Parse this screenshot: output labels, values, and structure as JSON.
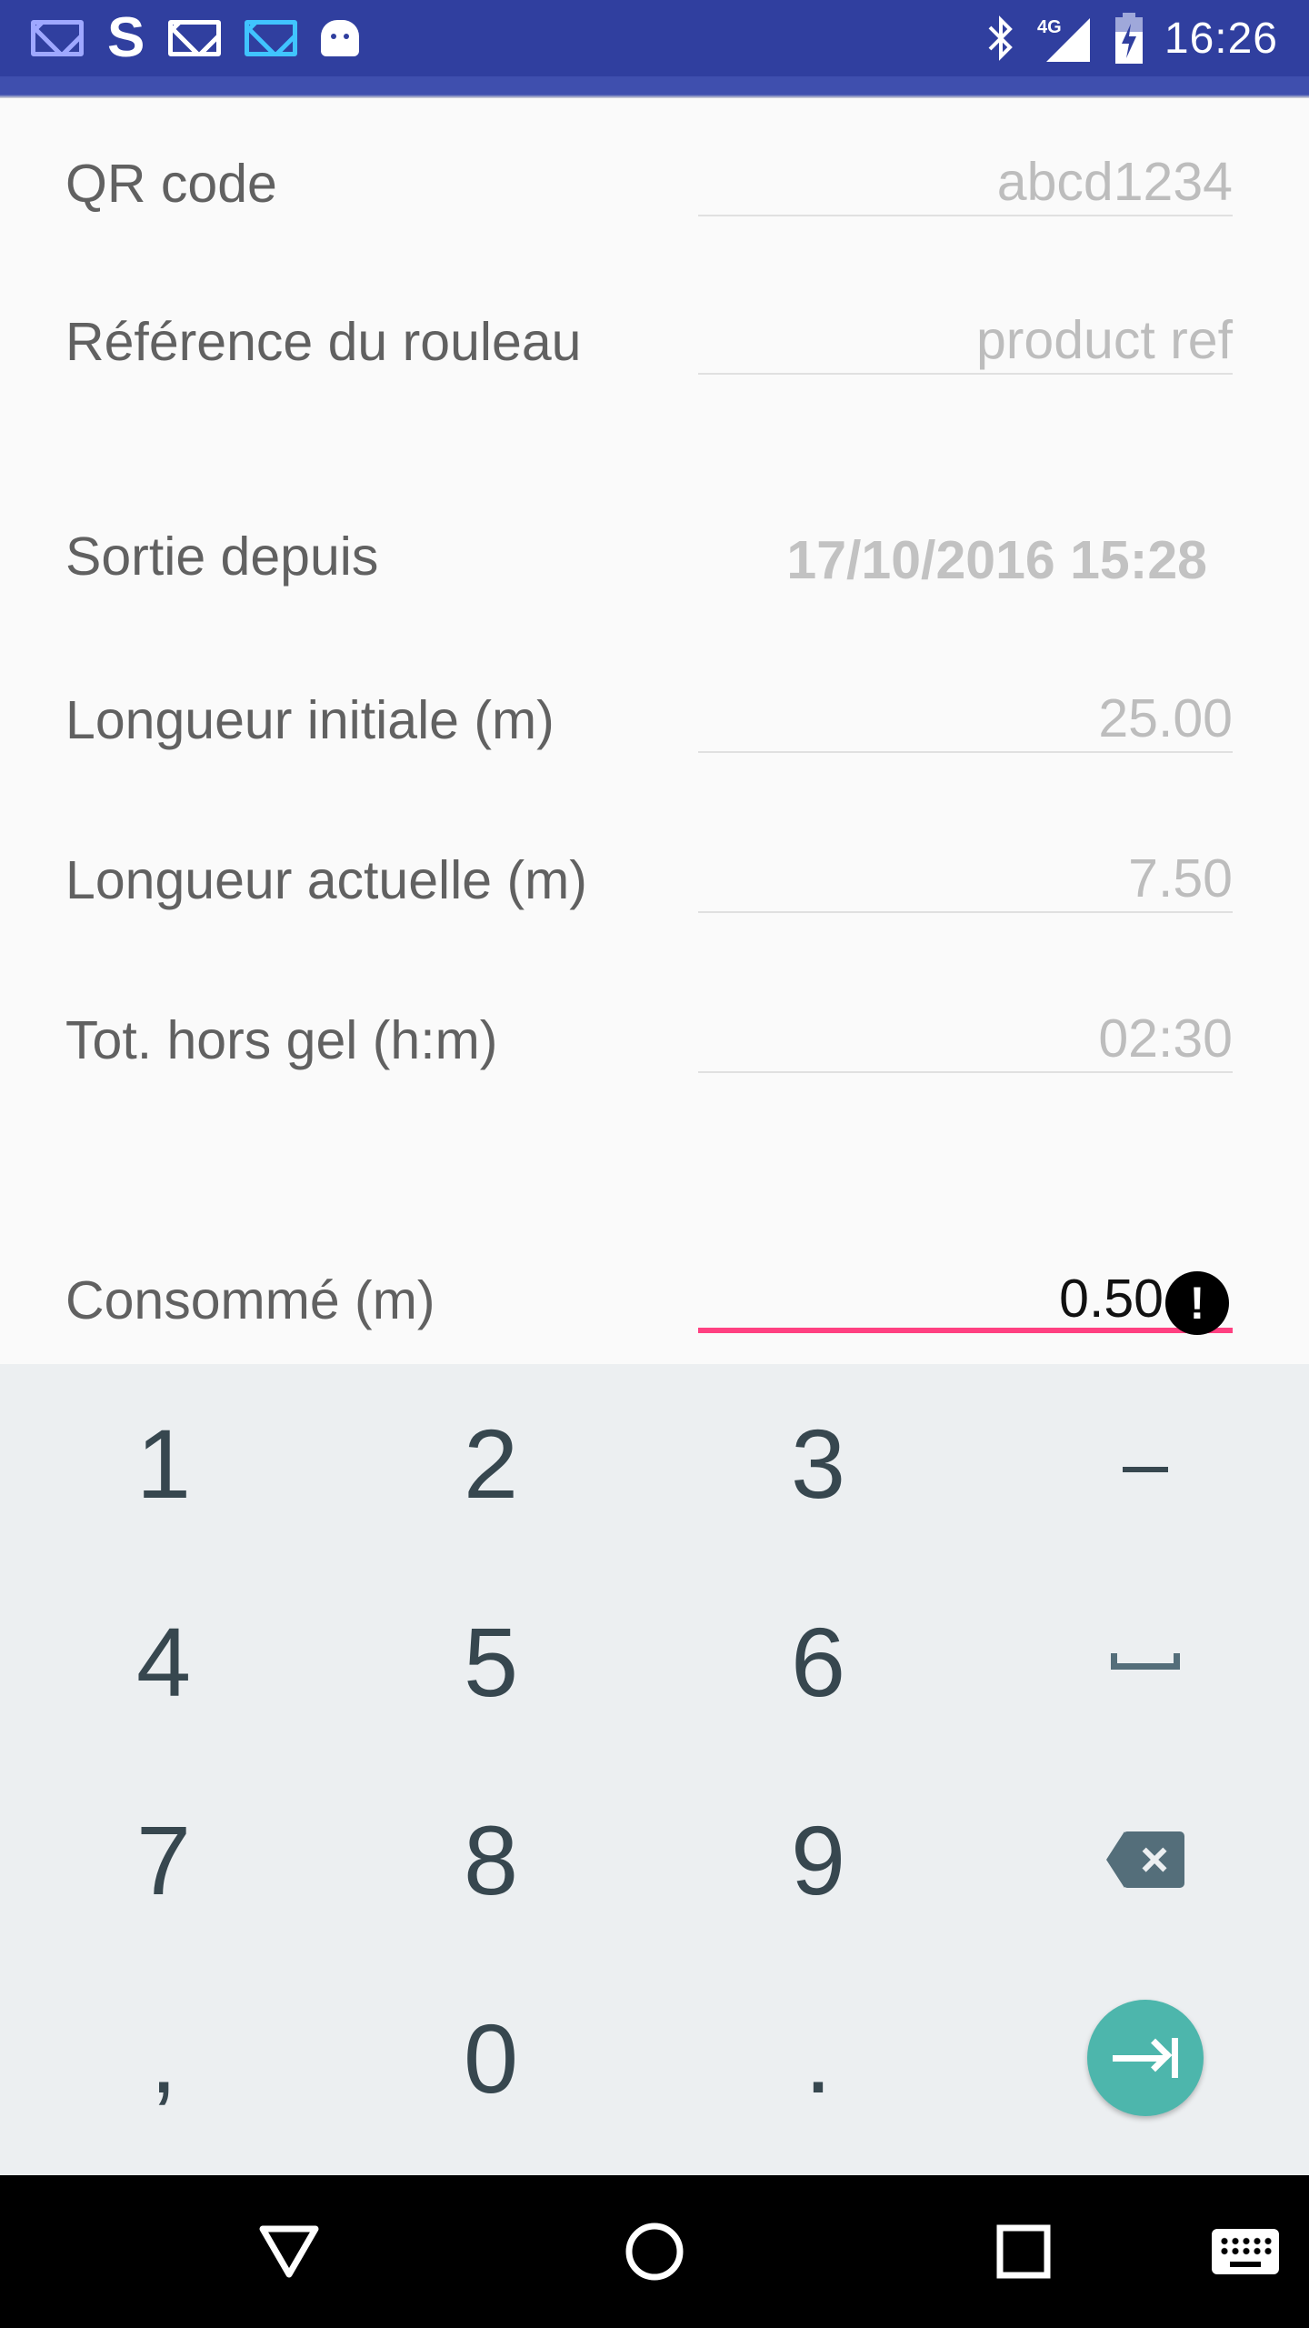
{
  "status_bar": {
    "time": "16:26",
    "network": "4G",
    "icons": [
      "mail-icon",
      "s-app-icon",
      "mail-icon",
      "mail-icon",
      "android-icon",
      "bluetooth-icon",
      "signal-icon",
      "battery-charging-icon"
    ]
  },
  "form": {
    "qr_code": {
      "label": "QR code",
      "value": "abcd1234"
    },
    "roll_reference": {
      "label": "Référence du rouleau",
      "placeholder": "product ref"
    },
    "out_since": {
      "label": "Sortie depuis",
      "value": "17/10/2016 15:28"
    },
    "initial_length": {
      "label": "Longueur initiale (m)",
      "value": "25.00"
    },
    "current_length": {
      "label": "Longueur actuelle (m)",
      "value": "7.50"
    },
    "total_unfrozen": {
      "label": "Tot. hors gel (h:m)",
      "value": "02:30"
    },
    "consumed": {
      "label": "Consommé (m)",
      "value": "0.50",
      "error": true
    }
  },
  "keyboard": {
    "rows": [
      [
        "1",
        "2",
        "3",
        "–"
      ],
      [
        "4",
        "5",
        "6",
        "space"
      ],
      [
        "7",
        "8",
        "9",
        "backspace"
      ],
      [
        ",",
        "0",
        ".",
        "next"
      ]
    ],
    "accent_color": "#4db6ac"
  },
  "colors": {
    "status_bar": "#303f9f",
    "active_underline": "#ff4081",
    "keyboard_background": "#eceff1"
  }
}
